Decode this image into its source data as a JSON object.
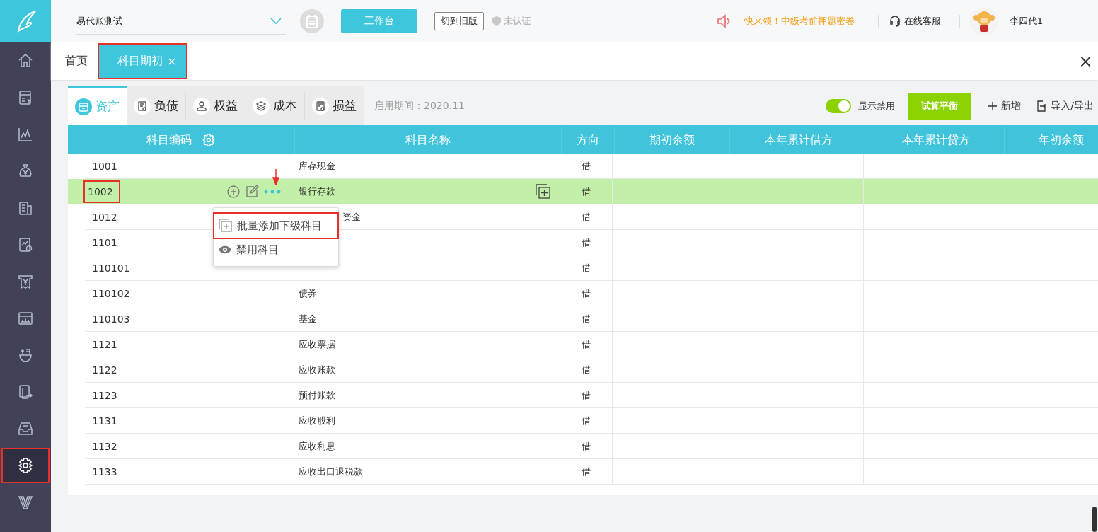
{
  "header": {
    "company": "易代账测试",
    "workbench_button": "工作台",
    "old_version_button": "切到旧版",
    "certification": "未认证",
    "promo": "快来领！中级考前押题密卷",
    "service": "在线客服",
    "user": "李四代1"
  },
  "sidebar": {
    "items": [
      {
        "kind": "home",
        "selected": false,
        "highlighted": false
      },
      {
        "kind": "voucher",
        "selected": false,
        "highlighted": false
      },
      {
        "kind": "chart",
        "selected": false,
        "highlighted": false
      },
      {
        "kind": "moneybag",
        "selected": false,
        "highlighted": false
      },
      {
        "kind": "building",
        "selected": false,
        "highlighted": false
      },
      {
        "kind": "report",
        "selected": false,
        "highlighted": false
      },
      {
        "kind": "receipt",
        "selected": false,
        "highlighted": false
      },
      {
        "kind": "screen",
        "selected": false,
        "highlighted": false
      },
      {
        "kind": "bowl",
        "selected": false,
        "highlighted": false
      },
      {
        "kind": "export",
        "selected": false,
        "highlighted": false
      },
      {
        "kind": "inbox",
        "selected": false,
        "highlighted": false
      },
      {
        "kind": "gear",
        "selected": true,
        "highlighted": true
      },
      {
        "kind": "v",
        "selected": false,
        "highlighted": false
      }
    ]
  },
  "page_tabs": [
    {
      "label": "首页",
      "selected": false,
      "highlighted": false
    },
    {
      "label": "科目期初",
      "selected": true,
      "close": "×",
      "highlighted": true
    }
  ],
  "close_all": "×",
  "category_tabs": [
    {
      "label": "资产",
      "selected": true
    },
    {
      "label": "负债",
      "selected": false
    },
    {
      "label": "权益",
      "selected": false
    },
    {
      "label": "成本",
      "selected": false
    },
    {
      "label": "损益",
      "selected": false
    }
  ],
  "period": "启用期间：2020.11",
  "show_disabled": {
    "label": "显示禁用",
    "on": true
  },
  "trial_balance_button": "试算平衡",
  "add_button": "新增",
  "import_export_button": "导入/导出",
  "table": {
    "columns": [
      "科目编码",
      "科目名称",
      "方向",
      "期初余额",
      "本年累计借方",
      "本年累计贷方",
      "年初余额"
    ],
    "rows": [
      {
        "code": "1001",
        "name": "库存现金",
        "direction": "借",
        "selected": false,
        "highlighted": false
      },
      {
        "code": "1002",
        "name": "银行存款",
        "direction": "借",
        "selected": true,
        "highlighted": true
      },
      {
        "code": "1012",
        "name": "资金",
        "direction": "借",
        "selected": false,
        "highlighted": false
      },
      {
        "code": "1101",
        "name": "",
        "direction": "借",
        "selected": false,
        "highlighted": false
      },
      {
        "code": "110101",
        "name": "",
        "direction": "借",
        "selected": false,
        "highlighted": false
      },
      {
        "code": "110102",
        "name": "债券",
        "direction": "借",
        "selected": false,
        "highlighted": false
      },
      {
        "code": "110103",
        "name": "基金",
        "direction": "借",
        "selected": false,
        "highlighted": false
      },
      {
        "code": "1121",
        "name": "应收票据",
        "direction": "借",
        "selected": false,
        "highlighted": false
      },
      {
        "code": "1122",
        "name": "应收账款",
        "direction": "借",
        "selected": false,
        "highlighted": false
      },
      {
        "code": "1123",
        "name": "预付账款",
        "direction": "借",
        "selected": false,
        "highlighted": false
      },
      {
        "code": "1131",
        "name": "应收股利",
        "direction": "借",
        "selected": false,
        "highlighted": false
      },
      {
        "code": "1132",
        "name": "应收利息",
        "direction": "借",
        "selected": false,
        "highlighted": false
      },
      {
        "code": "1133",
        "name": "应收出口退税款",
        "direction": "借",
        "selected": false,
        "highlighted": false
      }
    ]
  },
  "row_menu": [
    {
      "label": "批量添加下级科目",
      "highlighted": true
    },
    {
      "label": "禁用科目",
      "highlighted": false
    }
  ]
}
